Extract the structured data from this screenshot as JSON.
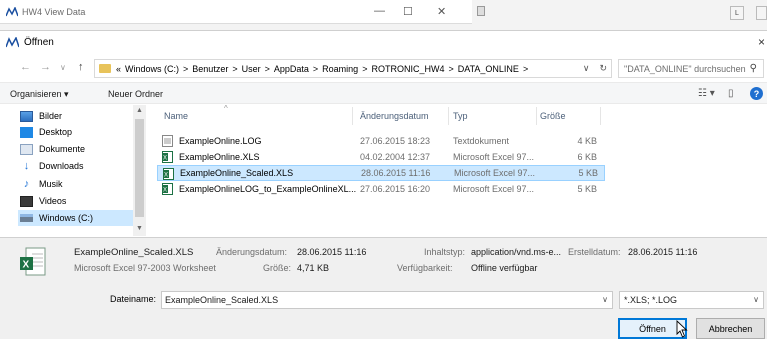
{
  "background_window": {
    "title": "HW4 View Data"
  },
  "dialog": {
    "title": "Öffnen",
    "close_glyph": "×"
  },
  "address_bar": {
    "back": "←",
    "forward": "→",
    "recent": "∨",
    "up": "↑",
    "overflow": "«",
    "path": [
      "Windows (C:)",
      "Benutzer",
      "User",
      "AppData",
      "Roaming",
      "ROTRONIC_HW4",
      "DATA_ONLINE"
    ],
    "separator": ">",
    "dropdown": "∨",
    "refresh": "↻",
    "search_placeholder": "\"DATA_ONLINE\" durchsuchen"
  },
  "toolbar": {
    "organize": "Organisieren ▾",
    "new_folder": "Neuer Ordner",
    "view_glyph": "☷ ▾",
    "pane_glyph": "▯",
    "help_glyph": "?"
  },
  "nav_pane": {
    "items": [
      {
        "label": "Bilder",
        "icon": "pictures-icon"
      },
      {
        "label": "Desktop",
        "icon": "desktop-icon"
      },
      {
        "label": "Dokumente",
        "icon": "documents-icon"
      },
      {
        "label": "Downloads",
        "icon": "downloads-icon"
      },
      {
        "label": "Musik",
        "icon": "music-icon"
      },
      {
        "label": "Videos",
        "icon": "videos-icon"
      },
      {
        "label": "Windows (C:)",
        "icon": "drive-icon"
      }
    ],
    "selected_index": 6
  },
  "file_list": {
    "columns": {
      "name": "Name",
      "date": "Änderungsdatum",
      "type": "Typ",
      "size": "Größe"
    },
    "rows": [
      {
        "name": "ExampleOnline.LOG",
        "date": "27.06.2015 18:23",
        "type": "Textdokument",
        "size": "4 KB",
        "icon": "text-file-icon"
      },
      {
        "name": "ExampleOnline.XLS",
        "date": "04.02.2004 12:37",
        "type": "Microsoft Excel 97...",
        "size": "6 KB",
        "icon": "excel-file-icon"
      },
      {
        "name": "ExampleOnline_Scaled.XLS",
        "date": "28.06.2015 11:16",
        "type": "Microsoft Excel 97...",
        "size": "5 KB",
        "icon": "excel-file-icon"
      },
      {
        "name": "ExampleOnlineLOG_to_ExampleOnlineXL...",
        "date": "27.06.2015 16:20",
        "type": "Microsoft Excel 97...",
        "size": "5 KB",
        "icon": "excel-file-icon"
      }
    ],
    "selected_index": 2
  },
  "details": {
    "filename": "ExampleOnline_Scaled.XLS",
    "filetype": "Microsoft Excel 97-2003 Worksheet",
    "modified_label": "Änderungsdatum:",
    "modified_value": "28.06.2015 11:16",
    "size_label": "Größe:",
    "size_value": "4,71 KB",
    "content_type_label": "Inhaltstyp:",
    "content_type_value": "application/vnd.ms-e...",
    "created_label": "Erstelldatum:",
    "created_value": "28.06.2015 11:16",
    "availability_label": "Verfügbarkeit:",
    "availability_value": "Offline verfügbar"
  },
  "bottom": {
    "filename_label": "Dateiname:",
    "filename_value": "ExampleOnline_Scaled.XLS",
    "filetype_value": "*.XLS; *.LOG",
    "open_button": "Öffnen",
    "cancel_button": "Abbrechen"
  },
  "colors": {
    "selection": "#cce8ff",
    "selection_border": "#99d1ff",
    "primary_button_border": "#0078d7",
    "folder": "#e8c35a",
    "excel_green": "#1d7144"
  }
}
